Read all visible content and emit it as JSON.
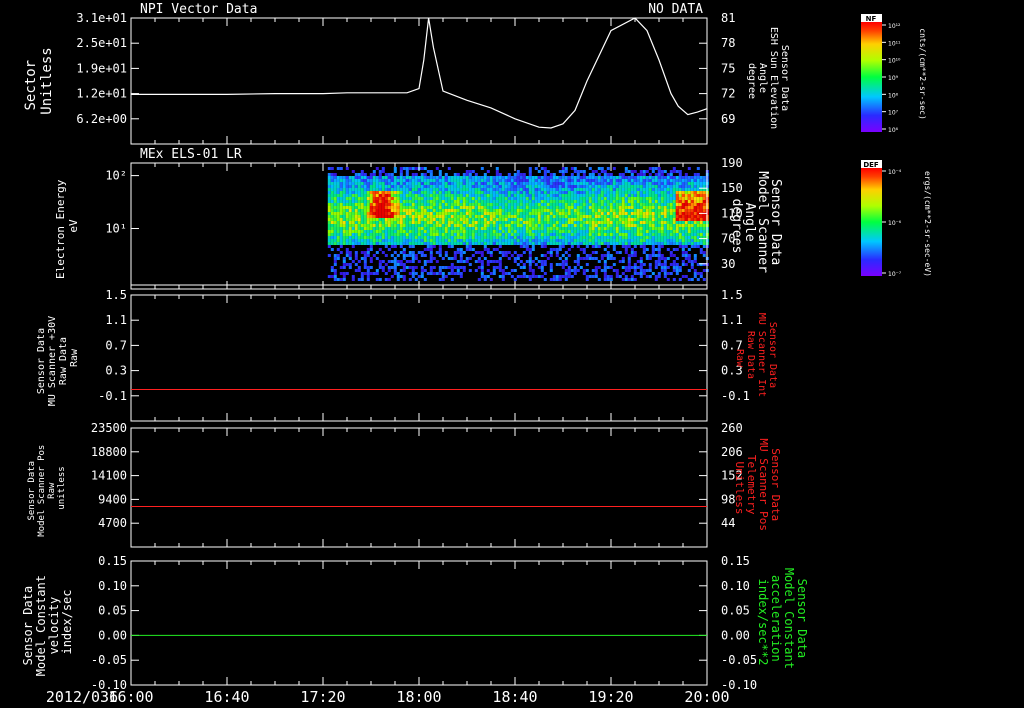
{
  "date_label": "2012/036",
  "time_ticks": [
    "16:00",
    "16:40",
    "17:20",
    "18:00",
    "18:40",
    "19:20",
    "20:00"
  ],
  "colors": {
    "white": "#ffffff",
    "red": "#ff2020",
    "green": "#22ee22",
    "background": "#000000"
  },
  "chart_data": [
    {
      "type": "line",
      "id": "panel1",
      "title": "NPI Vector Data",
      "status": "NO DATA",
      "ylabel": [
        "Sector",
        "Unitless"
      ],
      "y_ticks": [
        "3.1e+01",
        "2.5e+01",
        "1.9e+01",
        "1.2e+01",
        "6.2e+00"
      ],
      "y2label": [
        "Sensor Data",
        "ESH Sun Elevation",
        "Angle",
        "degree"
      ],
      "y2_ticks": [
        "81",
        "78",
        "75",
        "72",
        "69"
      ],
      "y2lim": [
        66,
        81
      ],
      "series": [
        {
          "x": [
            0,
            20,
            40,
            60,
            80,
            90,
            100,
            115,
            120,
            122,
            124,
            126,
            130,
            140,
            150,
            160,
            170,
            175,
            180,
            185,
            190,
            200,
            210,
            215,
            220,
            225,
            228,
            232,
            236,
            240
          ],
          "y": [
            71.9,
            71.9,
            71.9,
            72.0,
            72.0,
            72.1,
            72.1,
            72.1,
            72.6,
            76.0,
            81.0,
            77.5,
            72.3,
            71.2,
            70.3,
            69.0,
            68.0,
            67.9,
            68.4,
            70.0,
            73.5,
            79.5,
            81.0,
            79.5,
            76.0,
            72.0,
            70.5,
            69.5,
            69.8,
            70.2
          ]
        }
      ]
    },
    {
      "type": "heatmap",
      "id": "panel2",
      "title": "MEx ELS-01 LR",
      "ylabel": [
        "Electron Energy",
        "eV"
      ],
      "y_ticks": [
        "10²",
        "10¹"
      ],
      "y2label": [
        "Sensor Data",
        "Model Scanner",
        "Angle",
        "degrees"
      ],
      "y2_ticks": [
        "190",
        "150",
        "110",
        "70",
        "30"
      ],
      "y2lim": [
        0,
        190
      ],
      "series": [
        {
          "x": [
            0,
            240
          ],
          "y": [
            6,
            6
          ]
        }
      ]
    },
    {
      "type": "line",
      "id": "panel3",
      "ylabel": [
        "Sensor Data",
        "MU Scanner +30V",
        "Raw Data",
        "Raw"
      ],
      "y_ticks": [
        "1.5",
        "1.1",
        "0.7",
        "0.3",
        "-0.1"
      ],
      "y2label": [
        "Sensor Data",
        "MU Scanner Int",
        "Raw Data",
        "Raw"
      ],
      "y2_ticks": [
        "1.5",
        "1.1",
        "0.7",
        "0.3",
        "-0.1"
      ],
      "ylim": [
        -0.5,
        1.5
      ],
      "series": [
        {
          "x": [
            0,
            240
          ],
          "y": [
            0.0,
            0.0
          ]
        }
      ]
    },
    {
      "type": "line",
      "id": "panel4",
      "ylabel": [
        "Sensor Data",
        "Model Scanner Pos",
        "Raw",
        "unitless"
      ],
      "y_ticks": [
        "23500",
        "18800",
        "14100",
        "9400",
        "4700"
      ],
      "y2label": [
        "Sensor Data",
        "MU Scanner Pos",
        "Telemetry",
        "Unitless"
      ],
      "y2_ticks": [
        "260",
        "206",
        "152",
        "98",
        "44"
      ],
      "ylim": [
        0,
        23500
      ],
      "series": [
        {
          "x": [
            0,
            240
          ],
          "y": [
            8000,
            8000
          ]
        }
      ]
    },
    {
      "type": "line",
      "id": "panel5",
      "ylabel": [
        "Sensor Data",
        "Model Constant",
        "velocity",
        "index/sec"
      ],
      "y_ticks": [
        "0.15",
        "0.10",
        "0.05",
        "0.00",
        "-0.05",
        "-0.10"
      ],
      "y2label": [
        "Sensor Data",
        "Model Constant",
        "acceleration",
        "index/sec**2"
      ],
      "y2_ticks": [
        "0.15",
        "0.10",
        "0.05",
        "0.00",
        "-0.05",
        "-0.10"
      ],
      "ylim": [
        -0.1,
        0.15
      ],
      "series": [
        {
          "x": [
            0,
            240
          ],
          "y": [
            0.0,
            0.0
          ]
        }
      ]
    }
  ],
  "colorbars": [
    {
      "label": "NF",
      "units": "cnts/(cm**2-sr-sec)",
      "ticks": [
        "10¹²",
        "10¹¹",
        "10¹⁰",
        "10⁹",
        "10⁸",
        "10⁷",
        "10⁶"
      ]
    },
    {
      "label": "DEF",
      "units": "ergs/(cm**2-sr-sec-eV)",
      "ticks": [
        "10⁻⁴",
        "10⁻⁶",
        "10⁻⁷"
      ]
    }
  ]
}
